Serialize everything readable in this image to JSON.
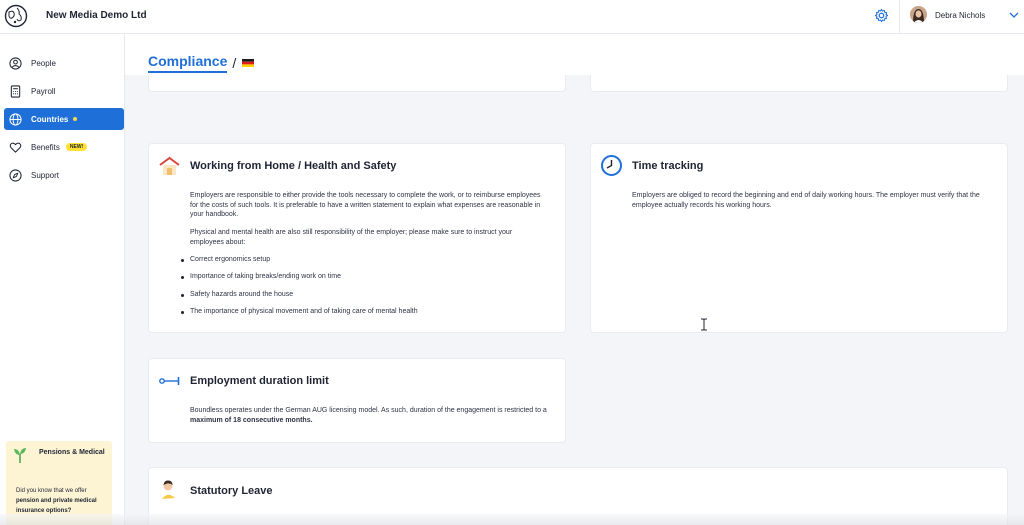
{
  "topbar": {
    "company": "New Media Demo Ltd",
    "user_name": "Debra Nichols"
  },
  "sidebar": {
    "items": [
      {
        "label": "People",
        "icon": "person-circle-icon"
      },
      {
        "label": "Payroll",
        "icon": "calculator-icon"
      },
      {
        "label": "Countries",
        "icon": "globe-icon",
        "active": true
      },
      {
        "label": "Benefits",
        "icon": "heart-icon",
        "badge": "NEW!"
      },
      {
        "label": "Support",
        "icon": "compass-icon"
      }
    ],
    "promo": {
      "title": "Pensions & Medical",
      "body_prefix": "Did you know that we offer ",
      "body_bold": "pension and private medical insurance options?"
    }
  },
  "header": {
    "title": "Compliance",
    "separator": "/"
  },
  "cards": {
    "wfh": {
      "title": "Working from Home / Health and Safety",
      "p1": "Employers are responsible to either provide the tools necessary to complete the work, or to reimburse employees for the costs of such tools. It is preferable to have a written statement to explain what expenses are reasonable in your handbook.",
      "p2": "Physical and mental health are also still responsibility of the employer; please make sure to instruct your employees about:",
      "bullets": [
        "Correct ergonomics setup",
        "Importance of taking breaks/ending work on time",
        "Safety hazards around the house",
        "The importance of physical movement and of taking care of mental health"
      ]
    },
    "time": {
      "title": "Time tracking",
      "p1": "Employers are obliged to record the beginning and end of daily working hours. The employer must verify that the employee actually records his working hours."
    },
    "duration": {
      "title": "Employment duration limit",
      "p1_prefix": "Boundless operates under the German AUG licensing model. As such, duration of the engagement is restricted to a ",
      "p1_bold": "maximum of 18 consecutive months."
    },
    "leave": {
      "title": "Statutory Leave"
    }
  },
  "colors": {
    "accent": "#1f6fd9",
    "badge_yellow": "#ffe033",
    "promo_bg": "#fdf4d4"
  }
}
